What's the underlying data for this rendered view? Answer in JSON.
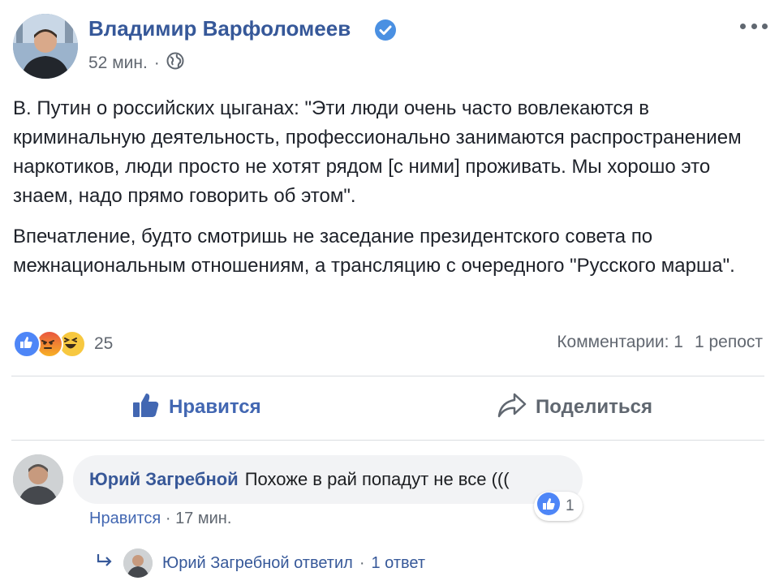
{
  "post": {
    "author": "Владимир Варфоломеев",
    "time": "52 мин.",
    "separator": "·",
    "paragraphs": [
      "В. Путин о российских цыганах: \"Эти люди очень часто вовлекаются в криминальную деятельность, профессионально занимаются распространением наркотиков, люди просто не хотят рядом [с ними] проживать. Мы хорошо это знаем, надо прямо говорить об этом\".",
      "Впечатление, будто смотришь не заседание президентского совета по межнациональным отношениям, а трансляцию с очередного \"Русского марша\"."
    ],
    "reaction_icons": [
      "like-reaction-icon",
      "angry-reaction-icon",
      "haha-reaction-icon"
    ],
    "reaction_count": "25",
    "comments_count": "Комментарии: 1",
    "shares_count": "1 репост"
  },
  "actions": {
    "like_label": "Нравится",
    "share_label": "Поделиться"
  },
  "comment": {
    "author": "Юрий Загребной",
    "text": "Похоже в рай попадут не все (((",
    "like_label": "Нравится",
    "separator": "·",
    "time": "17 мин.",
    "reaction_count": "1"
  },
  "reply": {
    "text": "Юрий Загребной ответил",
    "separator": "·",
    "count": "1 ответ"
  },
  "colors": {
    "link_blue": "#365899",
    "action_blue": "#4267b2",
    "meta_gray": "#616770",
    "bubble_bg": "#f2f3f5"
  }
}
